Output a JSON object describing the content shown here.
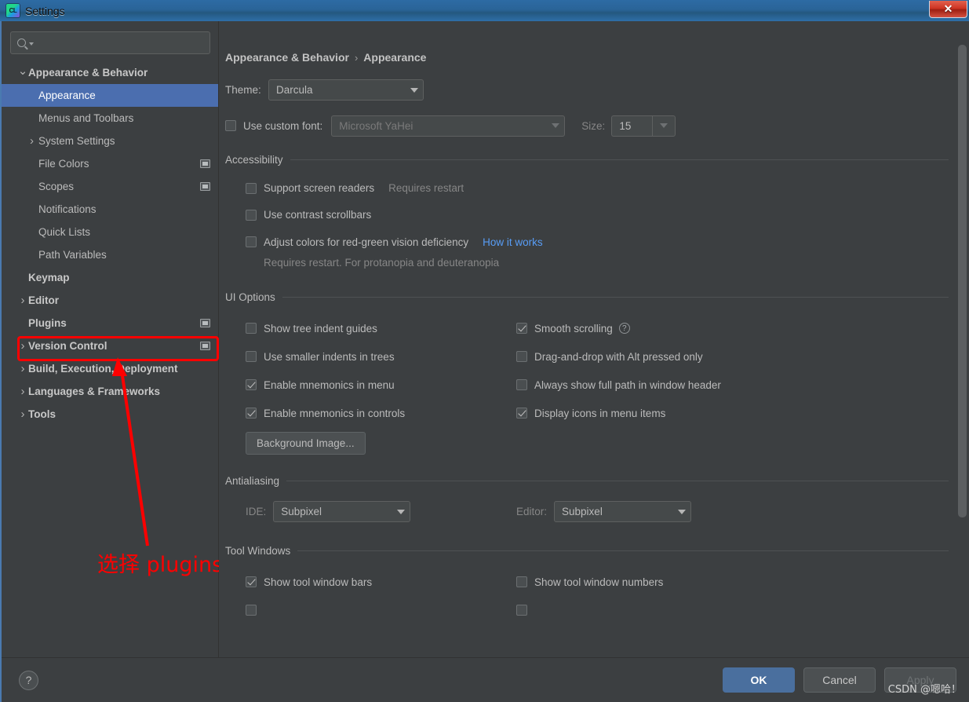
{
  "window": {
    "title": "Settings",
    "app_icon": "clion-icon",
    "close_label": "✕"
  },
  "sidebar": {
    "search": {
      "placeholder": "",
      "value": "",
      "icon": "search-icon"
    },
    "items": [
      {
        "label": "Appearance & Behavior",
        "level": 0,
        "arrow": "expanded",
        "bold": true,
        "selected": false,
        "badge": false
      },
      {
        "label": "Appearance",
        "level": 1,
        "arrow": "none",
        "bold": false,
        "selected": true,
        "badge": false
      },
      {
        "label": "Menus and Toolbars",
        "level": 1,
        "arrow": "none",
        "bold": false,
        "selected": false,
        "badge": false
      },
      {
        "label": "System Settings",
        "level": 1,
        "arrow": "collapsed",
        "bold": false,
        "selected": false,
        "badge": false
      },
      {
        "label": "File Colors",
        "level": 1,
        "arrow": "none",
        "bold": false,
        "selected": false,
        "badge": true
      },
      {
        "label": "Scopes",
        "level": 1,
        "arrow": "none",
        "bold": false,
        "selected": false,
        "badge": true
      },
      {
        "label": "Notifications",
        "level": 1,
        "arrow": "none",
        "bold": false,
        "selected": false,
        "badge": false
      },
      {
        "label": "Quick Lists",
        "level": 1,
        "arrow": "none",
        "bold": false,
        "selected": false,
        "badge": false
      },
      {
        "label": "Path Variables",
        "level": 1,
        "arrow": "none",
        "bold": false,
        "selected": false,
        "badge": false
      },
      {
        "label": "Keymap",
        "level": 0,
        "arrow": "none",
        "bold": true,
        "selected": false,
        "badge": false
      },
      {
        "label": "Editor",
        "level": 0,
        "arrow": "collapsed",
        "bold": true,
        "selected": false,
        "badge": false
      },
      {
        "label": "Plugins",
        "level": 0,
        "arrow": "none",
        "bold": true,
        "selected": false,
        "badge": true
      },
      {
        "label": "Version Control",
        "level": 0,
        "arrow": "collapsed",
        "bold": true,
        "selected": false,
        "badge": true
      },
      {
        "label": "Build, Execution, Deployment",
        "level": 0,
        "arrow": "collapsed",
        "bold": true,
        "selected": false,
        "badge": false
      },
      {
        "label": "Languages & Frameworks",
        "level": 0,
        "arrow": "collapsed",
        "bold": true,
        "selected": false,
        "badge": false
      },
      {
        "label": "Tools",
        "level": 0,
        "arrow": "collapsed",
        "bold": true,
        "selected": false,
        "badge": false
      }
    ]
  },
  "annotation": {
    "text": "选择 plugins",
    "color": "#fe0000",
    "highlight_target": "Plugins"
  },
  "main": {
    "breadcrumb": {
      "parent": "Appearance & Behavior",
      "separator": "›",
      "current": "Appearance"
    },
    "theme": {
      "label": "Theme:",
      "value": "Darcula"
    },
    "custom_font": {
      "checkbox_label": "Use custom font:",
      "checked": false,
      "font_value": "Microsoft YaHei",
      "size_label": "Size:",
      "size_value": "15"
    },
    "accessibility": {
      "title": "Accessibility",
      "items": [
        {
          "label": "Support screen readers",
          "checked": false,
          "hint": "Requires restart",
          "link": ""
        },
        {
          "label": "Use contrast scrollbars",
          "checked": false,
          "hint": "",
          "link": ""
        },
        {
          "label": "Adjust colors for red-green vision deficiency",
          "checked": false,
          "hint": "",
          "link": "How it works"
        }
      ],
      "note": "Requires restart. For protanopia and deuteranopia"
    },
    "ui_options": {
      "title": "UI Options",
      "left": [
        {
          "label": "Show tree indent guides",
          "checked": false,
          "help": false
        },
        {
          "label": "Use smaller indents in trees",
          "checked": false,
          "help": false
        },
        {
          "label": "Enable mnemonics in menu",
          "checked": true,
          "help": false
        },
        {
          "label": "Enable mnemonics in controls",
          "checked": true,
          "help": false
        }
      ],
      "right": [
        {
          "label": "Smooth scrolling",
          "checked": true,
          "help": true
        },
        {
          "label": "Drag-and-drop with Alt pressed only",
          "checked": false,
          "help": false
        },
        {
          "label": "Always show full path in window header",
          "checked": false,
          "help": false
        },
        {
          "label": "Display icons in menu items",
          "checked": true,
          "help": false
        }
      ],
      "background_image_button": "Background Image..."
    },
    "antialiasing": {
      "title": "Antialiasing",
      "ide_label": "IDE:",
      "ide_value": "Subpixel",
      "editor_label": "Editor:",
      "editor_value": "Subpixel"
    },
    "tool_windows": {
      "title": "Tool Windows",
      "left": [
        {
          "label": "Show tool window bars",
          "checked": true
        }
      ],
      "right": [
        {
          "label": "Show tool window numbers",
          "checked": false
        }
      ]
    }
  },
  "footer": {
    "help_label": "?",
    "ok_label": "OK",
    "cancel_label": "Cancel",
    "apply_label": "Apply",
    "apply_disabled": true,
    "watermark": "CSDN @嗯哈！"
  },
  "colors": {
    "accent": "#4b6eaf",
    "panel": "#3c3f41",
    "annotation": "#fe0000",
    "link": "#589df6"
  }
}
